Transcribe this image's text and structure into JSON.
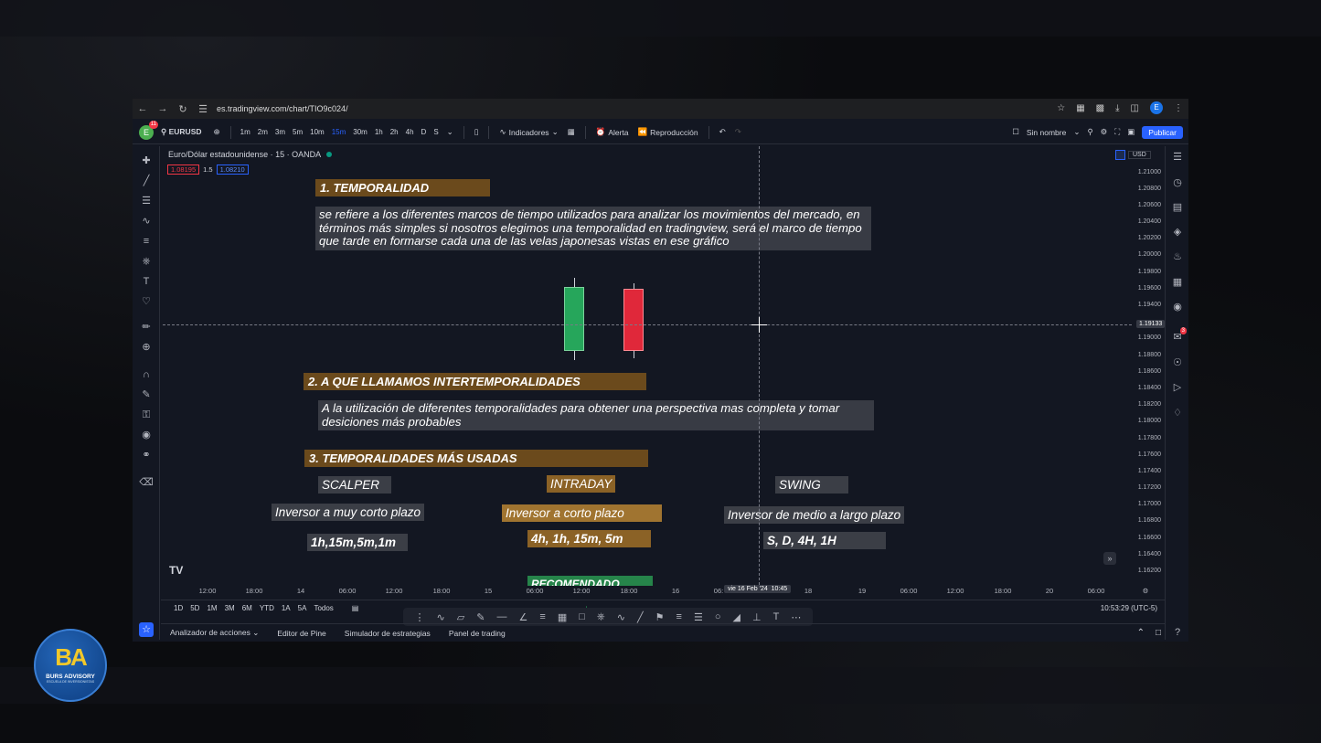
{
  "browser": {
    "url": "es.tradingview.com/chart/TIO9c024/",
    "profile_initial": "E"
  },
  "toolbar": {
    "avatar": "E",
    "avatar_badge": "11",
    "symbol": "EURUSD",
    "timeframes": [
      "1m",
      "2m",
      "3m",
      "5m",
      "10m",
      "15m",
      "30m",
      "1h",
      "2h",
      "4h",
      "D",
      "S"
    ],
    "active_timeframe": "15m",
    "indicators_label": "Indicadores",
    "alert_label": "Alerta",
    "replay_label": "Reproducción",
    "layout_name": "Sin nombre",
    "publish_label": "Publicar"
  },
  "legend": {
    "title": "Euro/Dólar estadounidense · 15 · OANDA",
    "bid": "1.08195",
    "spread": "1.5",
    "ask": "1.08210"
  },
  "price_axis": {
    "currency": "USD",
    "labels": [
      "1.21000",
      "1.20800",
      "1.20600",
      "1.20400",
      "1.20200",
      "1.20000",
      "1.19800",
      "1.19600",
      "1.19400",
      "1.19133",
      "1.19000",
      "1.18800",
      "1.18600",
      "1.18400",
      "1.18200",
      "1.18000",
      "1.17800",
      "1.17600",
      "1.17400",
      "1.17200",
      "1.17000",
      "1.16800",
      "1.16600",
      "1.16400",
      "1.16200"
    ],
    "crosshair_price": "1.19133"
  },
  "time_axis": {
    "labels": [
      "12:00",
      "18:00",
      "14",
      "06:00",
      "12:00",
      "18:00",
      "15",
      "06:00",
      "12:00",
      "18:00",
      "16",
      "06:",
      "18",
      "19",
      "06:00",
      "12:00",
      "18:00",
      "20",
      "06:00"
    ],
    "crosshair_date": "vie 16 Feb '24",
    "crosshair_time": "10:45"
  },
  "annotations": {
    "h1": "1. TEMPORALIDAD",
    "p1": "se refiere a los diferentes marcos de tiempo utilizados para analizar los movimientos del mercado, en términos más simples si nosotros elegimos una temporalidad en tradingview, será el marco de tiempo que tarde en formarse cada una de las velas japonesas vistas en ese gráfico",
    "h2": "2. A QUE LLAMAMOS INTERTEMPORALIDADES",
    "p2": "A la utilización de diferentes temporalidades para obtener una perspectiva mas completa y tomar desiciones más probables",
    "h3": "3. TEMPORALIDADES MÁS USADAS",
    "scalper": "SCALPER",
    "scalper_desc": "Inversor a muy corto plazo",
    "scalper_tf": "1h,15m,5m,1m",
    "intraday": "INTRADAY",
    "intraday_desc": "Inversor a corto plazo",
    "intraday_tf": "4h, 1h, 15m, 5m",
    "intraday_rec": "RECOMENDADO",
    "swing": "SWING",
    "swing_desc": "Inversor de medio a largo plazo",
    "swing_tf": "S, D, 4H, 1H"
  },
  "range_bar": {
    "ranges": [
      "1D",
      "5D",
      "1M",
      "3M",
      "6M",
      "YTD",
      "1A",
      "5A",
      "Todos"
    ],
    "clock": "10:53:29 (UTC-5)"
  },
  "panel_tabs": [
    "Analizador de acciones",
    "Editor de Pine",
    "Simulador de estrategias",
    "Panel de trading"
  ],
  "brand": {
    "logo": "BA",
    "name": "BURS ADVISORY",
    "sub": "ESCUELA DE INVERSIONISTAS"
  },
  "colors": {
    "accent": "#2962ff",
    "bull": "#26a65b",
    "bear": "#e0283a",
    "annotation_header": "#6b4a1c"
  }
}
